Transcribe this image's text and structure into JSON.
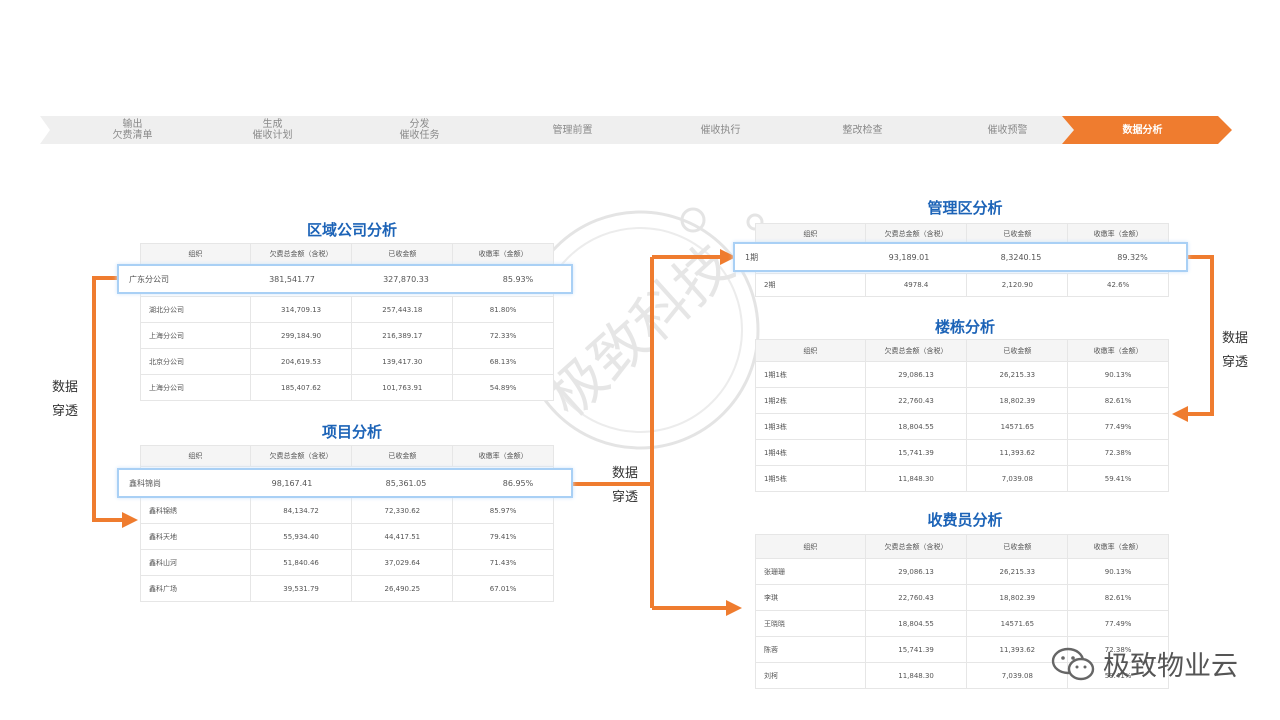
{
  "process": {
    "steps": [
      {
        "label": "输出\n欠费清单",
        "active": false
      },
      {
        "label": "生成\n催收计划",
        "active": false
      },
      {
        "label": "分发\n催收任务",
        "active": false
      },
      {
        "label": "管理前置",
        "active": false
      },
      {
        "label": "催收执行",
        "active": false
      },
      {
        "label": "整改检查",
        "active": false
      },
      {
        "label": "催收预警",
        "active": false
      },
      {
        "label": "数据分析",
        "active": true
      }
    ],
    "colors": {
      "inactive": "#efefef",
      "active": "#ef7c2f"
    }
  },
  "headers": [
    "组织",
    "欠费总金额（含税）",
    "已收金额",
    "收缴率（金额）"
  ],
  "regional": {
    "title": "区域公司分析",
    "highlight": [
      "广东分公司",
      "381,541.77",
      "327,870.33",
      "85.93%"
    ],
    "rows": [
      [
        "湖北分公司",
        "314,709.13",
        "257,443.18",
        "81.80%"
      ],
      [
        "上海分公司",
        "299,184.90",
        "216,389.17",
        "72.33%"
      ],
      [
        "北京分公司",
        "204,619.53",
        "139,417.30",
        "68.13%"
      ],
      [
        "上海分公司",
        "185,407.62",
        "101,763.91",
        "54.89%"
      ]
    ]
  },
  "project": {
    "title": "项目分析",
    "highlight": [
      "鑫科锦尚",
      "98,167.41",
      "85,361.05",
      "86.95%"
    ],
    "rows": [
      [
        "鑫科锦绣",
        "84,134.72",
        "72,330.62",
        "85.97%"
      ],
      [
        "鑫科天地",
        "55,934.40",
        "44,417.51",
        "79.41%"
      ],
      [
        "鑫科山河",
        "51,840.46",
        "37,029.64",
        "71.43%"
      ],
      [
        "鑫科广场",
        "39,531.79",
        "26,490.25",
        "67.01%"
      ]
    ]
  },
  "management": {
    "title": "管理区分析",
    "highlight": [
      "1期",
      "93,189.01",
      "8,3240.15",
      "89.32%"
    ],
    "rows": [
      [
        "2期",
        "4978.4",
        "2,120.90",
        "42.6%"
      ]
    ]
  },
  "building": {
    "title": "楼栋分析",
    "rows": [
      [
        "1期1栋",
        "29,086.13",
        "26,215.33",
        "90.13%"
      ],
      [
        "1期2栋",
        "22,760.43",
        "18,802.39",
        "82.61%"
      ],
      [
        "1期3栋",
        "18,804.55",
        "14571.65",
        "77.49%"
      ],
      [
        "1期4栋",
        "15,741.39",
        "11,393.62",
        "72.38%"
      ],
      [
        "1期5栋",
        "11,848.30",
        "7,039.08",
        "59.41%"
      ]
    ]
  },
  "collector": {
    "title": "收费员分析",
    "rows": [
      [
        "张珊珊",
        "29,086.13",
        "26,215.33",
        "90.13%"
      ],
      [
        "李琪",
        "22,760.43",
        "18,802.39",
        "82.61%"
      ],
      [
        "王晓晓",
        "18,804.55",
        "14571.65",
        "77.49%"
      ],
      [
        "陈蓉",
        "15,741.39",
        "11,393.62",
        "72.38%"
      ],
      [
        "刘柯",
        "11,848.30",
        "7,039.08",
        "59.41%"
      ]
    ]
  },
  "drill_label": "数据\n穿透",
  "watermark_text": "极致科技",
  "brand": {
    "name": "极致物业云",
    "icon": "wechat-icon"
  },
  "colors": {
    "accent": "#ef7c2f",
    "title": "#1c63b7",
    "highlight_border": "#a9d0f5"
  }
}
